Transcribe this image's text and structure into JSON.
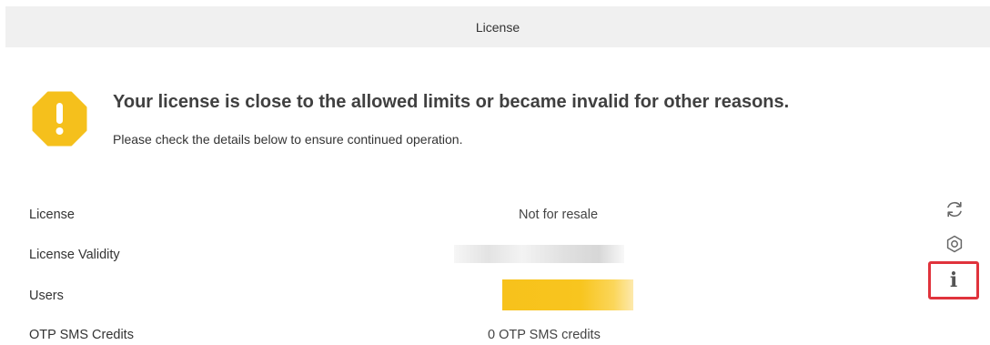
{
  "window": {
    "title": "License"
  },
  "alert": {
    "icon": "warning-octagon-icon",
    "icon_color": "#F5C01C",
    "headline": "Your license is close to the allowed limits or became invalid for other reasons.",
    "subline": "Please check the details below to ensure continued operation."
  },
  "details": {
    "rows": [
      {
        "label": "License",
        "value": "Not for resale"
      },
      {
        "label": "License Validity",
        "value": ""
      },
      {
        "label": "Users",
        "value": ""
      },
      {
        "label": "OTP SMS Credits",
        "value": "0 OTP SMS credits"
      }
    ]
  },
  "actions": {
    "refresh_icon": "refresh-icon",
    "settings_icon": "gear-icon",
    "info_icon": "info-icon",
    "info_glyph": "i",
    "highlight_color": "#E0333C"
  }
}
